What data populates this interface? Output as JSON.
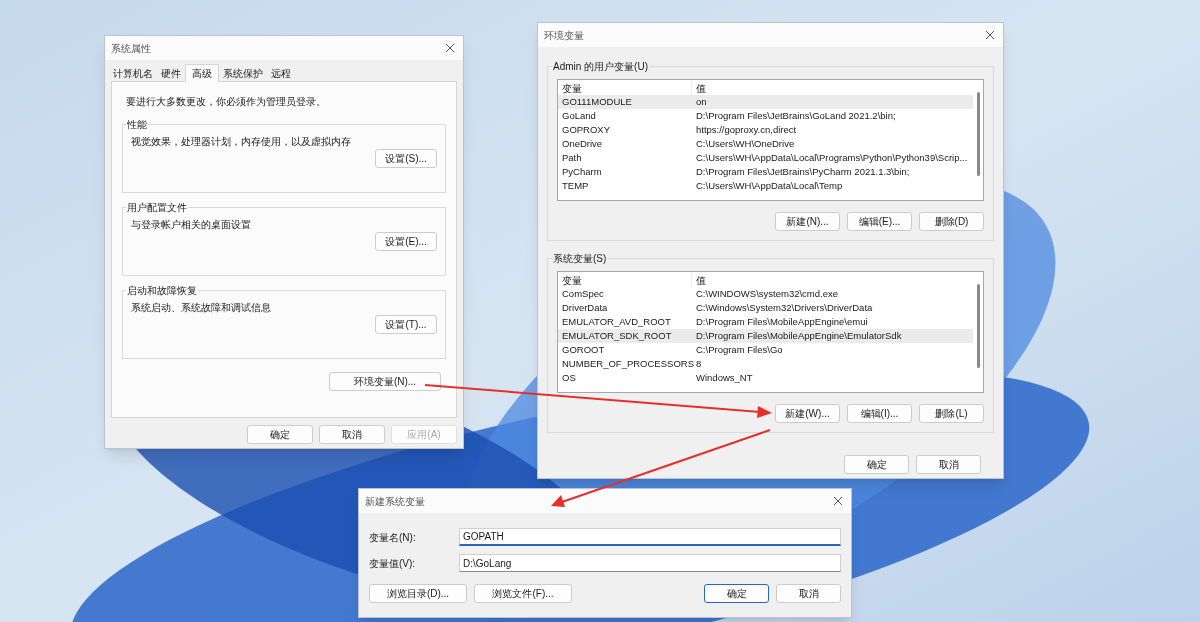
{
  "system_properties": {
    "title": "系统属性",
    "tabs": [
      {
        "label": "计算机名",
        "selected": false
      },
      {
        "label": "硬件",
        "selected": false
      },
      {
        "label": "高级",
        "selected": true
      },
      {
        "label": "系统保护",
        "selected": false
      },
      {
        "label": "远程",
        "selected": false
      }
    ],
    "note": "要进行大多数更改，你必须作为管理员登录。",
    "groups": [
      {
        "title": "性能",
        "description": "视觉效果，处理器计划，内存使用，以及虚拟内存",
        "button": "设置(S)..."
      },
      {
        "title": "用户配置文件",
        "description": "与登录帐户相关的桌面设置",
        "button": "设置(E)..."
      },
      {
        "title": "启动和故障恢复",
        "description": "系统启动、系统故障和调试信息",
        "button": "设置(T)..."
      }
    ],
    "env_button": "环境变量(N)...",
    "buttons": [
      {
        "label": "确定",
        "disabled": false
      },
      {
        "label": "取消",
        "disabled": false
      },
      {
        "label": "应用(A)",
        "disabled": true
      }
    ]
  },
  "environment_variables": {
    "title": "环境变量",
    "lists": [
      {
        "title": "Admin 的用户变量(U)",
        "columns": [
          "变量",
          "值"
        ],
        "rows": [
          {
            "name": "GO111MODULE",
            "value": "on",
            "selected": true
          },
          {
            "name": "GoLand",
            "value": "D:\\Program Files\\JetBrains\\GoLand 2021.2\\bin;",
            "selected": false
          },
          {
            "name": "GOPROXY",
            "value": "https://goproxy.cn,direct",
            "selected": false
          },
          {
            "name": "OneDrive",
            "value": "C:\\Users\\WH\\OneDrive",
            "selected": false
          },
          {
            "name": "Path",
            "value": "C:\\Users\\WH\\AppData\\Local\\Programs\\Python\\Python39\\Scrip...",
            "selected": false
          },
          {
            "name": "PyCharm",
            "value": "D:\\Program Files\\JetBrains\\PyCharm 2021.1.3\\bin;",
            "selected": false
          },
          {
            "name": "TEMP",
            "value": "C:\\Users\\WH\\AppData\\Local\\Temp",
            "selected": false
          }
        ],
        "buttons": [
          "新建(N)...",
          "编辑(E)...",
          "删除(D)"
        ]
      },
      {
        "title": "系统变量(S)",
        "columns": [
          "变量",
          "值"
        ],
        "rows": [
          {
            "name": "ComSpec",
            "value": "C:\\WINDOWS\\system32\\cmd.exe",
            "selected": false
          },
          {
            "name": "DriverData",
            "value": "C:\\Windows\\System32\\Drivers\\DriverData",
            "selected": false
          },
          {
            "name": "EMULATOR_AVD_ROOT",
            "value": "D:\\Program Files\\MobileAppEngine\\emui",
            "selected": false
          },
          {
            "name": "EMULATOR_SDK_ROOT",
            "value": "D:\\Program Files\\MobileAppEngine\\EmulatorSdk",
            "selected": true
          },
          {
            "name": "GOROOT",
            "value": "C:\\Program Files\\Go",
            "selected": false
          },
          {
            "name": "NUMBER_OF_PROCESSORS",
            "value": "8",
            "selected": false
          },
          {
            "name": "OS",
            "value": "Windows_NT",
            "selected": false
          }
        ],
        "buttons": [
          "新建(W)...",
          "编辑(I)...",
          "删除(L)"
        ]
      }
    ],
    "buttons": [
      "确定",
      "取消"
    ]
  },
  "new_system_variable": {
    "title": "新建系统变量",
    "fields": [
      {
        "label": "变量名(N):",
        "value": "GOPATH",
        "focused": true
      },
      {
        "label": "变量值(V):",
        "value": "D:\\GoLang",
        "focused": false
      }
    ],
    "buttons": [
      {
        "label": "浏览目录(D)...",
        "default": false
      },
      {
        "label": "浏览文件(F)...",
        "default": false
      },
      {
        "label": "确定",
        "default": true
      },
      {
        "label": "取消",
        "default": false
      }
    ]
  }
}
